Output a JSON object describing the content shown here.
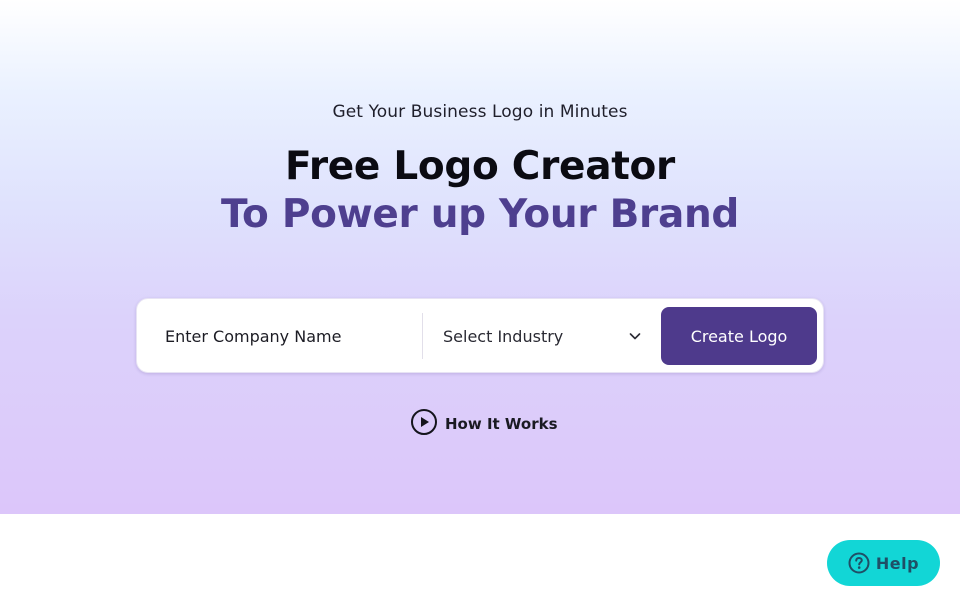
{
  "hero": {
    "tagline": "Get Your Business Logo in Minutes",
    "title": "Free Logo Creator",
    "subtitle": "To Power up Your Brand"
  },
  "search": {
    "company_placeholder": "Enter Company Name",
    "company_value": "",
    "industry_label": "Select Industry",
    "industry_icon": "chevron-down-icon",
    "create_label": "Create Logo"
  },
  "how_it_works": {
    "label": "How It Works",
    "icon": "play-circle-icon"
  },
  "help": {
    "label": "Help",
    "icon": "question-circle-icon"
  },
  "colors": {
    "brand_purple": "#4e3a8c",
    "subtitle_purple": "#4e3f8f",
    "help_teal": "#12d6d6"
  }
}
